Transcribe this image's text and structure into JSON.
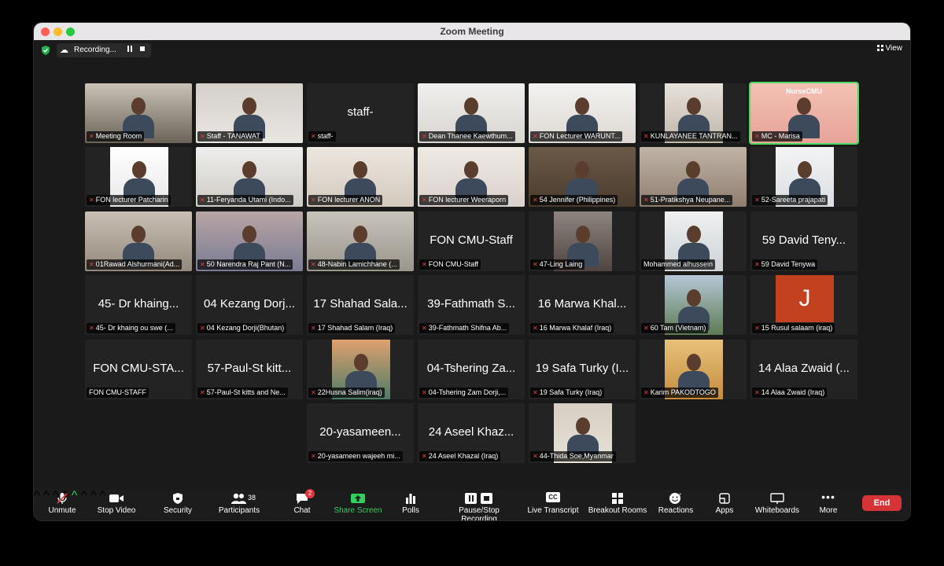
{
  "window": {
    "title": "Zoom Meeting"
  },
  "recording": {
    "label": "Recording..."
  },
  "view": {
    "label": "View"
  },
  "tiles": [
    {
      "type": "video",
      "label": "Meeting Room"
    },
    {
      "type": "video",
      "label": "Staff - TANAWAT"
    },
    {
      "type": "name",
      "big": "staff-",
      "label": "staff-"
    },
    {
      "type": "video",
      "label": "Dean Thanee Kaewthum..."
    },
    {
      "type": "video",
      "label": "FON Lecturer WARUNT..."
    },
    {
      "type": "video",
      "label": "KUNLAYANEE TANTRAN..."
    },
    {
      "type": "video",
      "label": "MC - Marisa",
      "active": true,
      "banner": "NurseCMU"
    },
    {
      "type": "video",
      "label": "FON lecturer Patcharin"
    },
    {
      "type": "video",
      "label": "11-Feryanda Utami (Indo..."
    },
    {
      "type": "video",
      "label": "FON lecturer ANON"
    },
    {
      "type": "video",
      "label": "FON lecturer Weeraporn"
    },
    {
      "type": "video",
      "label": "54 Jennifer (Philippines)"
    },
    {
      "type": "video",
      "label": "51-Pratikshya Neupane..."
    },
    {
      "type": "video",
      "label": "52-Sareeta prajapati"
    },
    {
      "type": "video",
      "label": "01Rawad Alshurmani(Ad..."
    },
    {
      "type": "video",
      "label": "50 Narendra Raj Pant (N..."
    },
    {
      "type": "video",
      "label": "48-Nabin Lamichhane (..."
    },
    {
      "type": "name",
      "big": "FON CMU-Staff",
      "label": "FON CMU-Staff"
    },
    {
      "type": "video",
      "label": "47-Ling Laing"
    },
    {
      "type": "video",
      "label": "Mohammed alhussein",
      "nomic": true
    },
    {
      "type": "name",
      "big": "59 David  Teny...",
      "label": "59 David  Tenywa"
    },
    {
      "type": "name",
      "big": "45- Dr khaing...",
      "label": "45- Dr khaing ou swe (..."
    },
    {
      "type": "name",
      "big": "04 Kezang Dorj...",
      "label": "04 Kezang Dorji(Bhutan)"
    },
    {
      "type": "name",
      "big": "17 Shahad Sala...",
      "label": "17 Shahad Salam (Iraq)"
    },
    {
      "type": "name",
      "big": "39-Fathmath S...",
      "label": "39-Fathmath Shifna Ab..."
    },
    {
      "type": "name",
      "big": "16 Marwa Khal...",
      "label": "16 Marwa Khalaf (Iraq)"
    },
    {
      "type": "video",
      "label": "60 Tam (Vietnam)"
    },
    {
      "type": "avatar",
      "letter": "J",
      "label": "15 Rusul salaam (iraq)"
    },
    {
      "type": "name",
      "big": "FON CMU-STA...",
      "label": "FON CMU-STAFF",
      "nomic": true
    },
    {
      "type": "name",
      "big": "57-Paul-St kitt...",
      "label": "57-Paul-St kitts and Ne..."
    },
    {
      "type": "video",
      "label": "22Husna Salim(iraq)"
    },
    {
      "type": "name",
      "big": "04-Tshering Za...",
      "label": "04-Tshering Zam Dorji,..."
    },
    {
      "type": "name",
      "big": "19 Safa Turky (I...",
      "label": "19 Safa Turky (Iraq)"
    },
    {
      "type": "video",
      "label": "Karim PAKODTOGO"
    },
    {
      "type": "name",
      "big": "14 Alaa Zwaid (...",
      "label": "14 Alaa Zwaid (Iraq)"
    },
    {
      "type": "name",
      "big": "20-yasameen...",
      "label": "20-yasameen wajeeh mi..."
    },
    {
      "type": "name",
      "big": "24 Aseel Khaz...",
      "label": "24 Aseel Khazal (Iraq)"
    },
    {
      "type": "video",
      "label": "44-Thida Soe,Myanmar"
    }
  ],
  "toolbar": {
    "unmute": "Unmute",
    "stop_video": "Stop Video",
    "security": "Security",
    "participants": "Participants",
    "participants_count": "38",
    "chat": "Chat",
    "chat_badge": "2",
    "share_screen": "Share Screen",
    "polls": "Polls",
    "pause_stop_recording": "Pause/Stop Recording",
    "live_transcript": "Live Transcript",
    "cc": "CC",
    "breakout_rooms": "Breakout Rooms",
    "reactions": "Reactions",
    "apps": "Apps",
    "whiteboards": "Whiteboards",
    "more": "More",
    "end": "End"
  },
  "colors": {
    "active_speaker": "#4cd964",
    "end_button": "#d53335",
    "share_green": "#2fd05b",
    "muted_red": "#e4433c"
  }
}
